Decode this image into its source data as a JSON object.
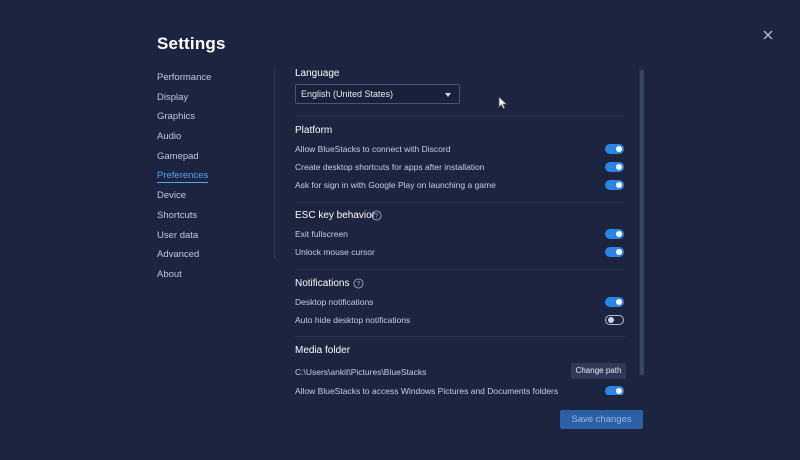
{
  "window": {
    "title": "Settings",
    "close_icon": "close-icon"
  },
  "nav": {
    "items": [
      {
        "label": "Performance",
        "active": false
      },
      {
        "label": "Display",
        "active": false
      },
      {
        "label": "Graphics",
        "active": false
      },
      {
        "label": "Audio",
        "active": false
      },
      {
        "label": "Gamepad",
        "active": false
      },
      {
        "label": "Preferences",
        "active": true
      },
      {
        "label": "Device",
        "active": false
      },
      {
        "label": "Shortcuts",
        "active": false
      },
      {
        "label": "User data",
        "active": false
      },
      {
        "label": "Advanced",
        "active": false
      },
      {
        "label": "About",
        "active": false
      }
    ]
  },
  "language": {
    "title": "Language",
    "selected": "English (United States)"
  },
  "platform": {
    "title": "Platform",
    "options": [
      {
        "label": "Allow BlueStacks to connect with Discord",
        "enabled": true
      },
      {
        "label": "Create desktop shortcuts for apps after installation",
        "enabled": true
      },
      {
        "label": "Ask for sign in with Google Play on launching a game",
        "enabled": true
      }
    ]
  },
  "esc": {
    "title": "ESC key behavior",
    "options": [
      {
        "label": "Exit fullscreen",
        "enabled": true
      },
      {
        "label": "Unlock mouse cursor",
        "enabled": true
      }
    ]
  },
  "notifications": {
    "title": "Notifications",
    "options": [
      {
        "label": "Desktop notifications",
        "enabled": true
      },
      {
        "label": "Auto hide desktop notifications",
        "enabled": false
      }
    ]
  },
  "media": {
    "title": "Media folder",
    "path": "C:\\Users\\ankit\\Pictures\\BlueStacks",
    "change_label": "Change path",
    "access_label": "Allow BlueStacks to access Windows Pictures and Documents folders",
    "access_enabled": true
  },
  "footer": {
    "save_label": "Save changes"
  },
  "colors": {
    "background": "#1c2440",
    "accent": "#2a86e6",
    "active_link": "#4ea6f6",
    "save_button": "#2b5fa6"
  }
}
